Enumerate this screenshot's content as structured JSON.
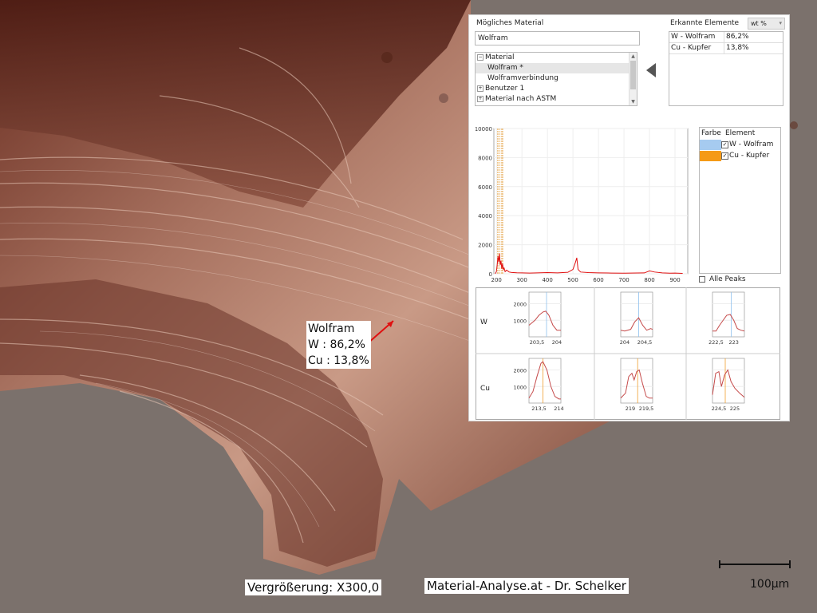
{
  "image": {
    "magnification_label": "Vergrößerung: X300,0",
    "credit_label": "Material-Analyse.at - Dr. Schelker",
    "scale_label": "100µm"
  },
  "annotation": {
    "title": "Wolfram",
    "line1": "W : 86,2%",
    "line2": "Cu : 13,8%"
  },
  "panel": {
    "material_heading": "Mögliches Material",
    "material_value": "Wolfram",
    "tree": [
      {
        "label": "Material",
        "expander": "−",
        "indent": false,
        "selected": false
      },
      {
        "label": "Wolfram *",
        "expander": "",
        "indent": true,
        "selected": true
      },
      {
        "label": "Wolframverbindung",
        "expander": "",
        "indent": true,
        "selected": false
      },
      {
        "label": "Benutzer 1",
        "expander": "+",
        "indent": false,
        "selected": false
      },
      {
        "label": "Material nach ASTM",
        "expander": "+",
        "indent": false,
        "selected": false
      }
    ],
    "elements_heading": "Erkannte Elemente",
    "unit": "wt %",
    "elements": [
      {
        "name": "W - Wolfram",
        "value": "86,2%"
      },
      {
        "name": "Cu - Kupfer",
        "value": "13,8%"
      }
    ],
    "legend": {
      "col_color": "Farbe",
      "col_element": "Element",
      "rows": [
        {
          "name": "W - Wolfram",
          "color": "#a6cbf0",
          "checked": true
        },
        {
          "name": "Cu - Kupfer",
          "color": "#f59a16",
          "checked": true
        }
      ]
    },
    "all_peaks_label": "Alle Peaks"
  },
  "chart_data": [
    {
      "type": "line",
      "title": "",
      "xlabel": "",
      "ylabel": "",
      "xlim": [
        190,
        950
      ],
      "ylim": [
        0,
        10000
      ],
      "x_ticks": [
        "200",
        "300",
        "400",
        "500",
        "600",
        "700",
        "800",
        "900"
      ],
      "y_ticks": [
        "0",
        "2000",
        "4000",
        "6000",
        "8000",
        "10000"
      ],
      "grid": true,
      "series": [
        {
          "color": "#e01010",
          "x": [
            195,
            200,
            203,
            206,
            209,
            212,
            215,
            218,
            221,
            224,
            227,
            230,
            234,
            240,
            250,
            260,
            280,
            300,
            330,
            360,
            400,
            440,
            480,
            500,
            510,
            515,
            520,
            530,
            560,
            600,
            650,
            700,
            780,
            800,
            820,
            850,
            880,
            900,
            930
          ],
          "y": [
            0,
            150,
            600,
            1200,
            800,
            1400,
            600,
            900,
            350,
            700,
            300,
            400,
            150,
            250,
            120,
            90,
            70,
            60,
            50,
            60,
            80,
            60,
            100,
            300,
            800,
            1100,
            300,
            120,
            80,
            60,
            50,
            40,
            60,
            200,
            120,
            60,
            40,
            50,
            30
          ]
        }
      ],
      "markers_x": [
        204,
        208,
        213,
        219,
        223,
        225
      ]
    },
    {
      "type": "line",
      "row": "W",
      "ylim": [
        0,
        2700
      ],
      "y_ticks": [
        "1000",
        "2000"
      ],
      "x_ticks": [
        "203,5",
        "204"
      ],
      "xlim": [
        203.3,
        204.1
      ],
      "marker": 203.74,
      "series": [
        {
          "color": "#c54a4a",
          "x": [
            203.3,
            203.45,
            203.55,
            203.65,
            203.72,
            203.8,
            203.9,
            204.0,
            204.1
          ],
          "y": [
            700,
            1000,
            1300,
            1500,
            1550,
            1300,
            700,
            400,
            400
          ]
        }
      ]
    },
    {
      "type": "line",
      "row": "W",
      "ylim": [
        0,
        2700
      ],
      "y_ticks": [],
      "x_ticks": [
        "204",
        "204,5"
      ],
      "xlim": [
        203.9,
        204.7
      ],
      "marker": 204.35,
      "series": [
        {
          "color": "#c54a4a",
          "x": [
            203.9,
            204.0,
            204.15,
            204.25,
            204.35,
            204.45,
            204.55,
            204.65,
            204.7
          ],
          "y": [
            400,
            350,
            450,
            900,
            1150,
            700,
            400,
            500,
            450
          ]
        }
      ]
    },
    {
      "type": "line",
      "row": "W",
      "ylim": [
        0,
        2700
      ],
      "y_ticks": [],
      "x_ticks": [
        "222,5",
        "223"
      ],
      "xlim": [
        222.4,
        223.3
      ],
      "marker": 222.93,
      "series": [
        {
          "color": "#c54a4a",
          "x": [
            222.4,
            222.5,
            222.6,
            222.7,
            222.8,
            222.9,
            223.0,
            223.1,
            223.2,
            223.3
          ],
          "y": [
            350,
            350,
            700,
            1000,
            1300,
            1350,
            1000,
            500,
            400,
            350
          ]
        }
      ]
    },
    {
      "type": "line",
      "row": "Cu",
      "ylim": [
        0,
        2700
      ],
      "y_ticks": [
        "1000",
        "2000"
      ],
      "x_ticks": [
        "213,5",
        "214"
      ],
      "xlim": [
        213.25,
        214.05
      ],
      "marker": 213.6,
      "series": [
        {
          "color": "#c54a4a",
          "x": [
            213.25,
            213.35,
            213.45,
            213.55,
            213.6,
            213.7,
            213.8,
            213.9,
            214.0,
            214.05
          ],
          "y": [
            300,
            700,
            1600,
            2400,
            2500,
            2000,
            1000,
            400,
            250,
            250
          ]
        }
      ]
    },
    {
      "type": "line",
      "row": "Cu",
      "ylim": [
        0,
        2700
      ],
      "y_ticks": [],
      "x_ticks": [
        "219",
        "219,5"
      ],
      "xlim": [
        218.7,
        219.7
      ],
      "marker": 219.23,
      "series": [
        {
          "color": "#c54a4a",
          "x": [
            218.7,
            218.85,
            218.95,
            219.05,
            219.12,
            219.2,
            219.28,
            219.38,
            219.5,
            219.6,
            219.7
          ],
          "y": [
            300,
            600,
            1600,
            1800,
            1400,
            1900,
            2000,
            1200,
            400,
            300,
            300
          ]
        }
      ]
    },
    {
      "type": "line",
      "row": "Cu",
      "ylim": [
        0,
        2700
      ],
      "y_ticks": [],
      "x_ticks": [
        "224,5",
        "225"
      ],
      "xlim": [
        224.3,
        225.3
      ],
      "marker": 224.7,
      "series": [
        {
          "color": "#c54a4a",
          "x": [
            224.3,
            224.4,
            224.5,
            224.58,
            224.68,
            224.78,
            224.88,
            225.0,
            225.15,
            225.3
          ],
          "y": [
            500,
            1800,
            1900,
            1000,
            1700,
            2000,
            1300,
            900,
            600,
            350
          ]
        }
      ]
    }
  ]
}
